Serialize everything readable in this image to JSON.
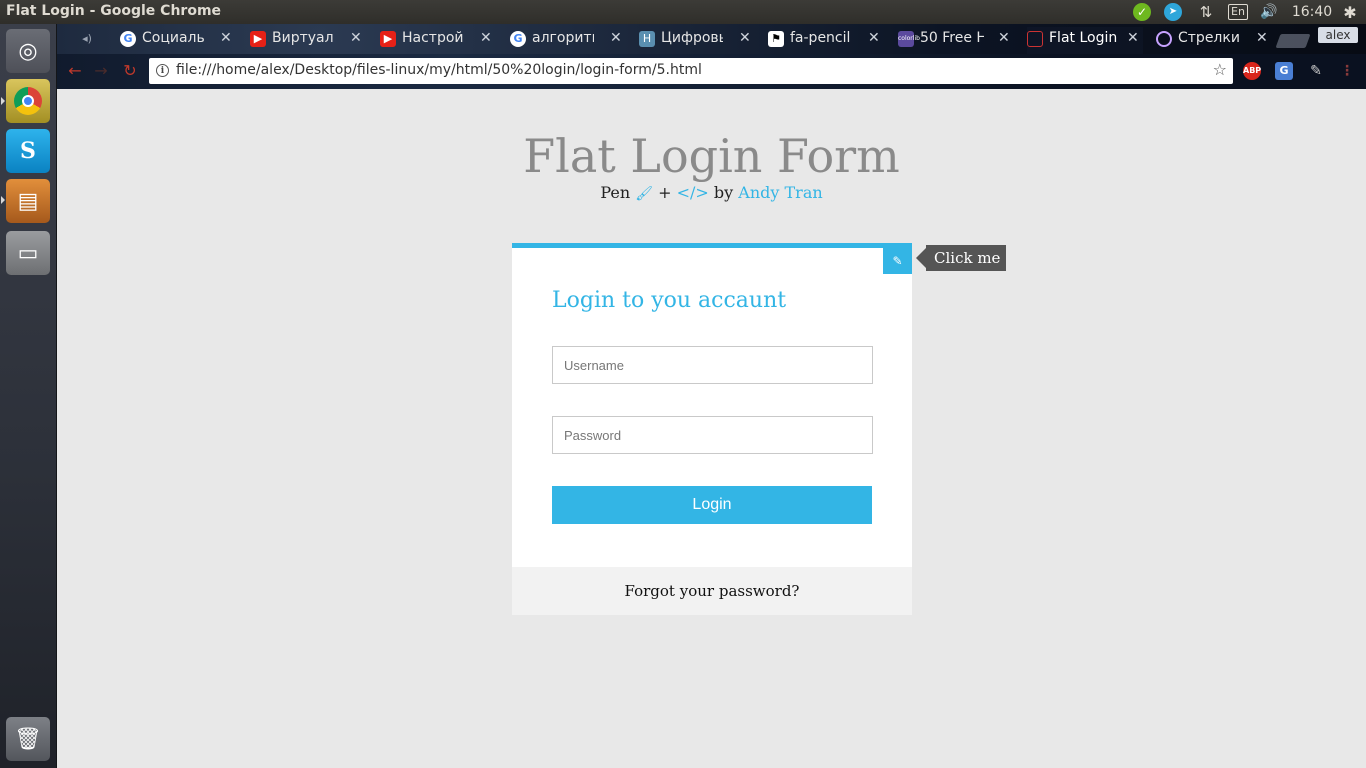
{
  "window": {
    "title": "Flat Login - Google Chrome"
  },
  "system_tray": {
    "lang": "En",
    "clock": "16:40",
    "network_glyph": "⇅",
    "volume_glyph": "🔊",
    "gear_glyph": "✱"
  },
  "launcher": {
    "items": [
      {
        "name": "dash-icon",
        "glyph": "◎"
      },
      {
        "name": "chrome-icon",
        "glyph": ""
      },
      {
        "name": "skype-icon",
        "glyph": "S"
      },
      {
        "name": "sublime-text-icon",
        "glyph": "▤"
      },
      {
        "name": "files-icon",
        "glyph": "▭"
      },
      {
        "name": "trash-icon",
        "glyph": "🗑"
      }
    ]
  },
  "tabs": [
    {
      "label": "",
      "favicon": "speaker-icon"
    },
    {
      "label": "Социальн",
      "favicon": "google-icon",
      "glyph": "G"
    },
    {
      "label": "Виртуаль",
      "favicon": "youtube-icon",
      "glyph": "▶"
    },
    {
      "label": "Настройк",
      "favicon": "youtube-icon",
      "glyph": "▶"
    },
    {
      "label": "алгоритм",
      "favicon": "google-icon",
      "glyph": "G"
    },
    {
      "label": "Цифровы",
      "favicon": "h-icon",
      "glyph": "H"
    },
    {
      "label": "fa-pencil",
      "favicon": "flag-icon",
      "glyph": "⚑"
    },
    {
      "label": "50 Free H",
      "favicon": "colorlib-icon",
      "glyph": "colorlib"
    },
    {
      "label": "Flat Login",
      "favicon": "file-icon",
      "glyph": ""
    },
    {
      "label": "Стрелки",
      "favicon": "circle-icon",
      "glyph": ""
    }
  ],
  "profile": {
    "name": "alex"
  },
  "toolbar": {
    "url": "file:///home/alex/Desktop/files-linux/my/html/50%20login/login-form/5.html",
    "extensions": {
      "abp": "ABP",
      "translate": "G"
    }
  },
  "page": {
    "title": "Flat Login Form",
    "credits": {
      "pen": "Pen",
      "plus": "+",
      "code": "</>",
      "by": "by",
      "author": "Andy Tran"
    },
    "form": {
      "heading": "Login to you accaunt",
      "username_placeholder": "Username",
      "password_placeholder": "Password",
      "login_label": "Login",
      "forgot_label": "Forgot your password?"
    },
    "toggle": {
      "tooltip": "Click me"
    }
  },
  "colors": {
    "accent": "#33b5e5",
    "page_bg": "#e8e8e8",
    "title": "#8a8a8a",
    "tooltip_bg": "#555555"
  }
}
